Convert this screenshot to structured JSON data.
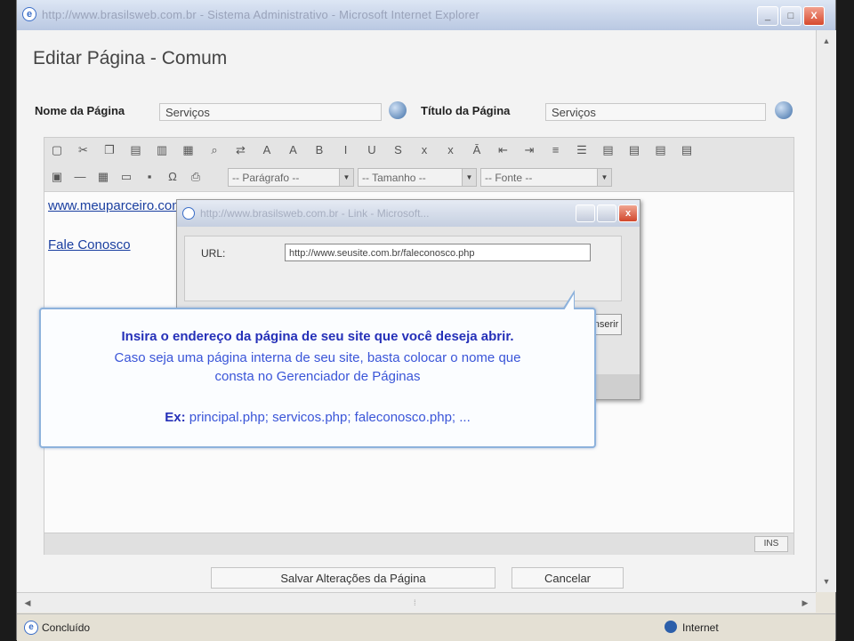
{
  "window": {
    "title": "http://www.brasilsweb.com.br - Sistema Administrativo - Microsoft Internet Explorer",
    "min": "_",
    "max": "□",
    "close": "X"
  },
  "page": {
    "heading": "Editar Página - Comum",
    "nome_label": "Nome da Página",
    "nome_value": "Serviços",
    "titulo_label": "Título da Página",
    "titulo_value": "Serviços"
  },
  "toolbar": {
    "paragraph_select": "-- Parágrafo --",
    "size_select": "-- Tamanho --",
    "font_select": "-- Fonte --",
    "icons": [
      "new-doc-icon",
      "cut-icon",
      "copy-icon",
      "paste-icon",
      "paste-text-icon",
      "paste-word-icon",
      "find-icon",
      "replace-icon",
      "text-color-icon",
      "bg-color-icon",
      "bold-icon",
      "italic-icon",
      "underline-icon",
      "strike-icon",
      "subscript-icon",
      "superscript-icon",
      "remove-format-icon",
      "outdent-icon",
      "indent-icon",
      "ordered-list-icon",
      "unordered-list-icon",
      "align-left-icon",
      "align-center-icon",
      "align-right-icon",
      "justify-icon"
    ],
    "icons2": [
      "image-icon",
      "horizontal-rule-icon",
      "table-icon",
      "textbox-icon",
      "save-icon",
      "special-char-icon",
      "print-icon"
    ]
  },
  "editor": {
    "link1": "www.meuparceiro.com",
    "link2": "Fale Conosco",
    "footer_badge": "INS"
  },
  "popup": {
    "title": "http://www.brasilsweb.com.br - Link - Microsoft...",
    "url_label": "URL:",
    "url_value": "http://www.seusite.com.br/faleconosco.php",
    "ok_label": "Inserir"
  },
  "tooltip": {
    "line1": "Insira o endereço da página de seu site que você deseja abrir.",
    "line2": "Caso seja uma página interna de seu site, basta colocar o nome que",
    "line3": "consta no Gerenciador de Páginas",
    "ex_label": "Ex:",
    "ex_text": " principal.php; servicos.php; faleconosco.php; ..."
  },
  "buttons": {
    "save": "Salvar Alterações da Página",
    "cancel": "Cancelar"
  },
  "status": {
    "left": "Concluído",
    "zone": "Internet"
  }
}
